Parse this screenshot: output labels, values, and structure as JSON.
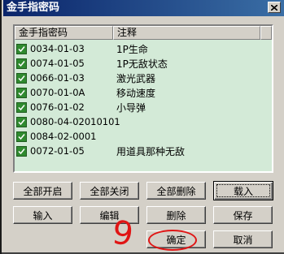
{
  "window": {
    "title": "金手指密码"
  },
  "list": {
    "columns": [
      "金手指密码",
      "注释"
    ],
    "rows": [
      {
        "code": "0034-01-03",
        "note": "1P生命",
        "checked": true
      },
      {
        "code": "0074-01-05",
        "note": "1P无敌状态",
        "checked": true
      },
      {
        "code": "0066-01-03",
        "note": "激光武器",
        "checked": true
      },
      {
        "code": "0070-01-0A",
        "note": "移动速度",
        "checked": true
      },
      {
        "code": "0076-01-02",
        "note": "小导弹",
        "checked": true
      },
      {
        "code": "0080-04-02010101",
        "note": "",
        "checked": true
      },
      {
        "code": "0084-02-0001",
        "note": "",
        "checked": true
      },
      {
        "code": "0072-01-05",
        "note": "用道具那种无敌",
        "checked": true
      }
    ],
    "background_color": "#d3ead7",
    "checkbox_color": "#2f8a2f"
  },
  "buttons": {
    "enable_all": "全部开启",
    "disable_all": "全部关闭",
    "delete_all": "全部删除",
    "load": "载入",
    "input": "输入",
    "edit": "编辑",
    "delete": "删除",
    "save": "保存",
    "ok": "确定",
    "cancel": "取消"
  },
  "annotation": {
    "number": "9",
    "color": "#e01515"
  }
}
